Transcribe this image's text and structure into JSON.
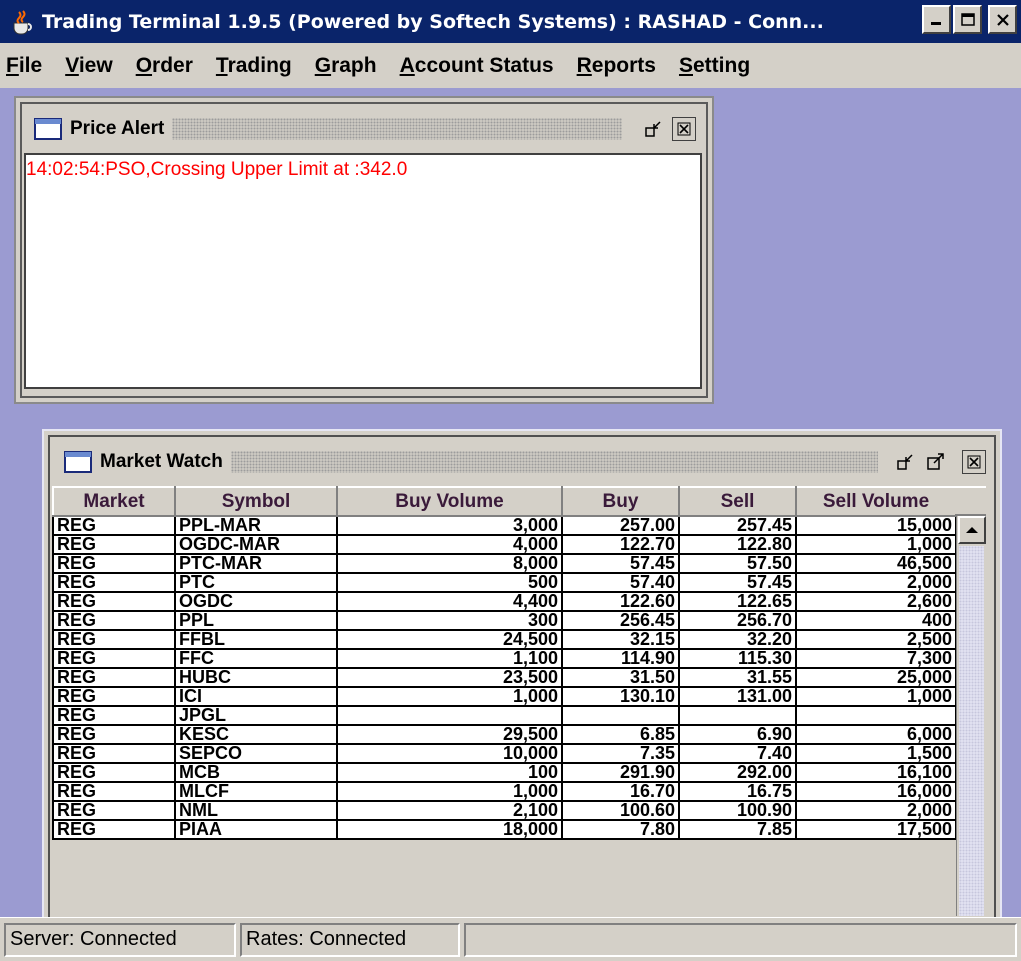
{
  "window": {
    "title": "Trading Terminal 1.9.5 (Powered by Softech Systems)  :  RASHAD - Conn...",
    "app_icon": "java-cup-icon",
    "controls": [
      "minimize-icon",
      "maximize-icon",
      "close-icon"
    ]
  },
  "menubar": {
    "items": [
      "File",
      "View",
      "Order",
      "Trading",
      "Graph",
      "Account Status",
      "Reports",
      "Setting"
    ],
    "mnemonics": [
      "F",
      "V",
      "O",
      "T",
      "G",
      "A",
      "R",
      "S"
    ]
  },
  "price_alert": {
    "title": "Price Alert",
    "icon": "window-icon",
    "controls": [
      "restore-icon",
      "close-icon"
    ],
    "messages": [
      "14:02:54:PSO,Crossing Upper Limit at :342.0"
    ],
    "message_color": "#ff0000"
  },
  "market_watch": {
    "title": "Market Watch",
    "icon": "window-icon",
    "controls": [
      "restore-icon",
      "maximize-icon",
      "close-icon"
    ],
    "columns": [
      "Market",
      "Symbol",
      "Buy Volume",
      "Buy",
      "Sell",
      "Sell Volume"
    ],
    "rows": [
      [
        "REG",
        "PPL-MAR",
        "3,000",
        "257.00",
        "257.45",
        "15,000"
      ],
      [
        "REG",
        "OGDC-MAR",
        "4,000",
        "122.70",
        "122.80",
        "1,000"
      ],
      [
        "REG",
        "PTC-MAR",
        "8,000",
        "57.45",
        "57.50",
        "46,500"
      ],
      [
        "REG",
        "PTC",
        "500",
        "57.40",
        "57.45",
        "2,000"
      ],
      [
        "REG",
        "OGDC",
        "4,400",
        "122.60",
        "122.65",
        "2,600"
      ],
      [
        "REG",
        "PPL",
        "300",
        "256.45",
        "256.70",
        "400"
      ],
      [
        "REG",
        "FFBL",
        "24,500",
        "32.15",
        "32.20",
        "2,500"
      ],
      [
        "REG",
        "FFC",
        "1,100",
        "114.90",
        "115.30",
        "7,300"
      ],
      [
        "REG",
        "HUBC",
        "23,500",
        "31.50",
        "31.55",
        "25,000"
      ],
      [
        "REG",
        "ICI",
        "1,000",
        "130.10",
        "131.00",
        "1,000"
      ],
      [
        "REG",
        "JPGL",
        "",
        "",
        "",
        ""
      ],
      [
        "REG",
        "KESC",
        "29,500",
        "6.85",
        "6.90",
        "6,000"
      ],
      [
        "REG",
        "SEPCO",
        "10,000",
        "7.35",
        "7.40",
        "1,500"
      ],
      [
        "REG",
        "MCB",
        "100",
        "291.90",
        "292.00",
        "16,100"
      ],
      [
        "REG",
        "MLCF",
        "1,000",
        "16.70",
        "16.75",
        "16,000"
      ],
      [
        "REG",
        "NML",
        "2,100",
        "100.60",
        "100.90",
        "2,000"
      ],
      [
        "REG",
        "PIAA",
        "18,000",
        "7.80",
        "7.85",
        "17,500"
      ]
    ]
  },
  "statusbar": {
    "server": "Server: Connected",
    "rates": "Rates: Connected",
    "extra": ""
  },
  "colors": {
    "titlebar": "#0a246a",
    "desktop": "#9b9bd1",
    "chrome": "#d4d0c8",
    "alert_text": "#ff0000"
  }
}
